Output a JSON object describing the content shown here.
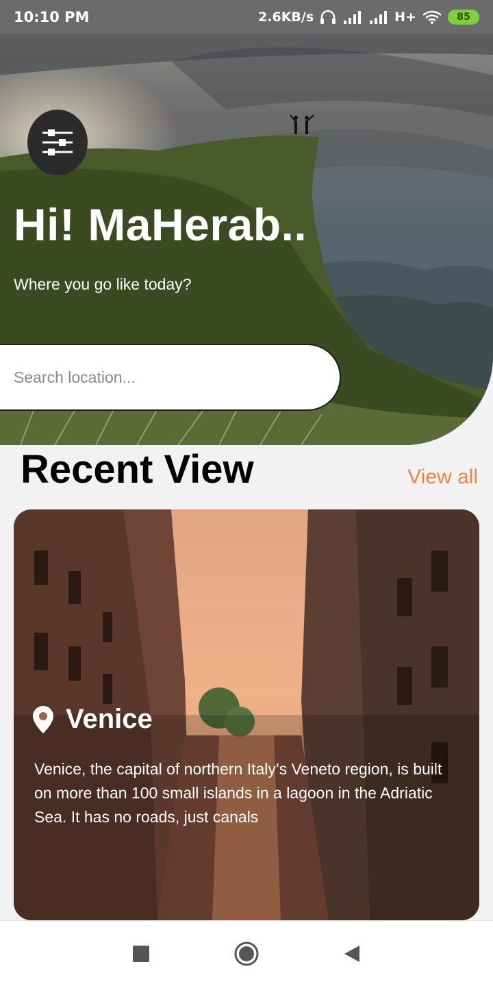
{
  "status_bar": {
    "time": "10:10 PM",
    "network_speed": "2.6KB/s",
    "network_type": "H+",
    "battery": "85"
  },
  "hero": {
    "greeting": "Hi! MaHerab..",
    "subtitle": "Where you go like today?",
    "search_placeholder": "Search location..."
  },
  "recent": {
    "title": "Recent View",
    "view_all": "View all"
  },
  "card": {
    "title": "Venice",
    "description": "Venice, the capital of northern Italy’s Veneto region, is built on more than 100 small islands in a lagoon in the Adriatic Sea. It has no roads, just canals"
  },
  "colors": {
    "accent": "#f0824a",
    "status_bar_bg": "#6b6b6b",
    "battery": "#7dd13b",
    "filter_button_bg": "#2b2b2b"
  },
  "icons": {
    "filter": "sliders-icon",
    "location": "map-pin-icon",
    "nav_recent": "square-icon",
    "nav_home": "circle-icon",
    "nav_back": "triangle-back-icon"
  }
}
